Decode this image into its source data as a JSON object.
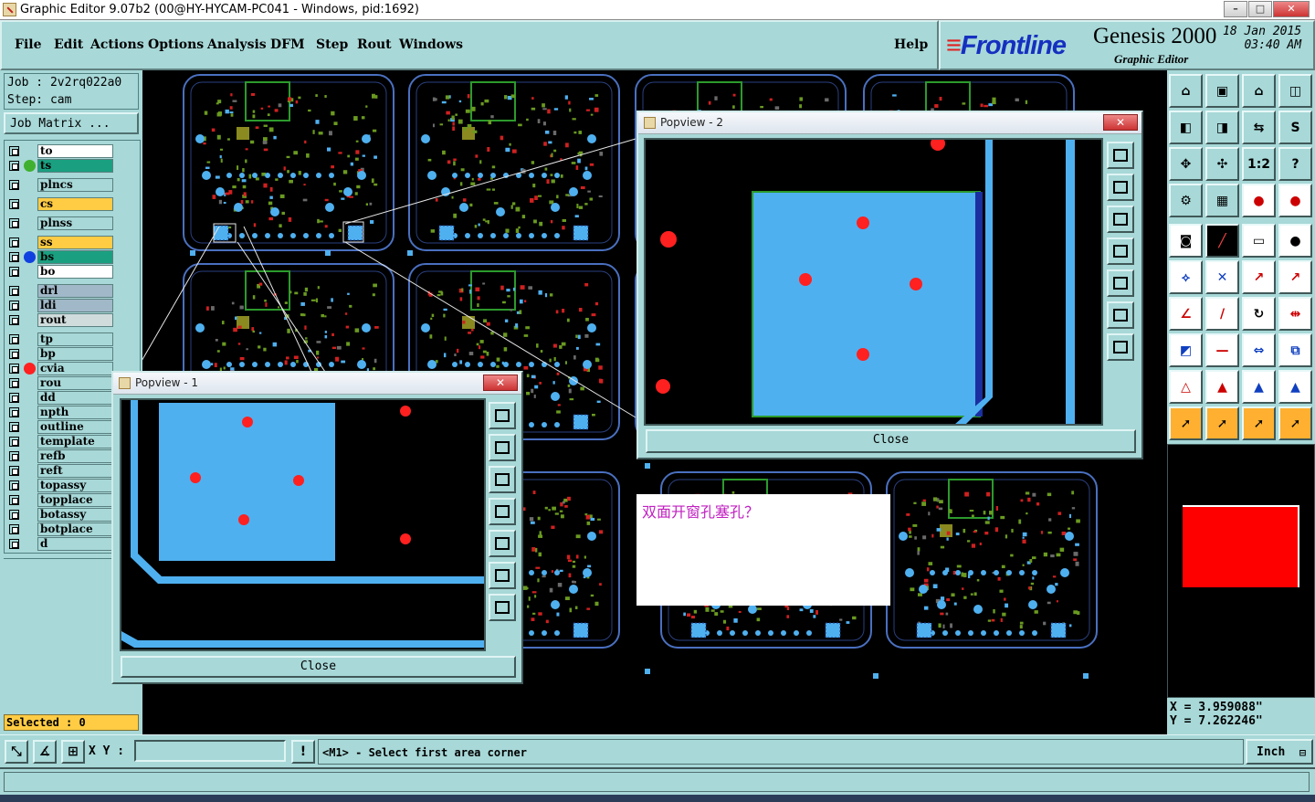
{
  "window": {
    "title": "Graphic Editor 9.07b2 (00@HY-HYCAM-PC041 - Windows, pid:1692)",
    "min": "–",
    "max": "□",
    "close": "✕"
  },
  "menu": {
    "items": [
      "File",
      "Edit",
      "Actions",
      "Options",
      "Analysis",
      "DFM",
      "Step",
      "Rout",
      "Windows"
    ],
    "help": "Help"
  },
  "brand": {
    "logo_mark": "≡",
    "logo": "Frontline",
    "product": "Genesis 2000",
    "subtitle": "Graphic Editor",
    "date": "18 Jan 2015",
    "time": "03:40 AM"
  },
  "job": {
    "job_line": "Job : 2v2rq022a0",
    "step_line": "Step: cam",
    "matrix_button": "Job Matrix ..."
  },
  "layers": [
    {
      "name": "to",
      "color": "#ffffff",
      "indicator": null
    },
    {
      "name": "ts",
      "color": "#1aa080",
      "indicator": "#40b030"
    },
    {
      "name": "plncs",
      "color": "#a8d8d8",
      "indicator": null
    },
    {
      "name": "cs",
      "color": "#ffcc44",
      "indicator": null
    },
    {
      "name": "plnss",
      "color": "#a8d8d8",
      "indicator": null
    },
    {
      "name": "ss",
      "color": "#ffcc44",
      "indicator": null
    },
    {
      "name": "bs",
      "color": "#1aa080",
      "indicator": "#1040e0"
    },
    {
      "name": "bo",
      "color": "#ffffff",
      "indicator": null
    },
    {
      "name": "drl",
      "color": "#a0b8c8",
      "indicator": null
    },
    {
      "name": "ldi",
      "color": "#a0b8c8",
      "indicator": null
    },
    {
      "name": "rout",
      "color": "#d0dcdc",
      "indicator": null
    },
    {
      "name": "tp",
      "color": "#a8d8d8",
      "indicator": null
    },
    {
      "name": "bp",
      "color": "#a8d8d8",
      "indicator": null
    },
    {
      "name": "cvia",
      "color": "#a8d8d8",
      "indicator": "#ff2020"
    },
    {
      "name": "rou",
      "color": "#a8d8d8",
      "indicator": null
    },
    {
      "name": "dd",
      "color": "#a8d8d8",
      "indicator": null
    },
    {
      "name": "npth",
      "color": "#a8d8d8",
      "indicator": null
    },
    {
      "name": "outline",
      "color": "#a8d8d8",
      "indicator": null
    },
    {
      "name": "template",
      "color": "#a8d8d8",
      "indicator": null
    },
    {
      "name": "refb",
      "color": "#a8d8d8",
      "indicator": null
    },
    {
      "name": "reft",
      "color": "#a8d8d8",
      "indicator": null
    },
    {
      "name": "topassy",
      "color": "#a8d8d8",
      "indicator": null
    },
    {
      "name": "topplace",
      "color": "#a8d8d8",
      "indicator": null
    },
    {
      "name": "botassy",
      "color": "#a8d8d8",
      "indicator": null
    },
    {
      "name": "botplace",
      "color": "#a8d8d8",
      "indicator": null
    },
    {
      "name": "d",
      "color": "#a8d8d8",
      "indicator": null
    }
  ],
  "selected": "Selected : 0",
  "popview1": {
    "title": "Popview - 1",
    "close_button": "Close",
    "titlebar_close": "✕"
  },
  "popview2": {
    "title": "Popview - 2",
    "close_button": "Close",
    "titlebar_close": "✕"
  },
  "comment": "双面开窗孔塞孔？",
  "toolbar": {
    "ratio_label": "1:2",
    "help_label": "?"
  },
  "coords": {
    "x": "X = 3.959088\"",
    "y": "Y = 7.262246\""
  },
  "command": {
    "xy_label": "X Y :",
    "xy_value": "",
    "message": "<M1> - Select first area corner",
    "units": "Inch",
    "alert": "!"
  },
  "colors": {
    "panel": "#a8d8d8",
    "pad": "#4fb0f0",
    "hole": "#ff2020",
    "outline": "#4a70c0"
  }
}
